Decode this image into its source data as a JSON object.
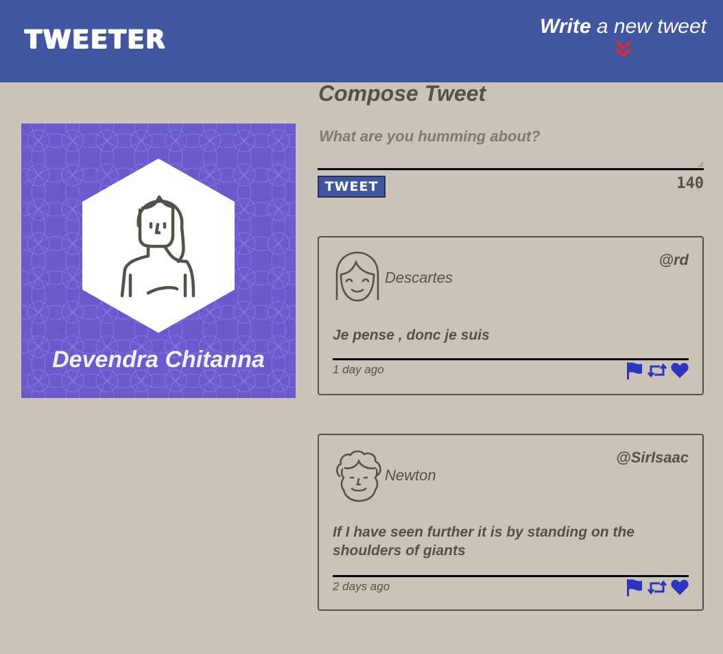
{
  "nav": {
    "logo": "TWEETER",
    "write_strong": "Write",
    "write_rest": " a new tweet",
    "chevron_color": "#e0282d",
    "icon": "double-chevron-down-icon"
  },
  "profile": {
    "name": "Devendra Chitanna",
    "background_color": "#6a5acd",
    "avatar_icon": "woman-avatar-icon"
  },
  "compose": {
    "title": "Compose Tweet",
    "placeholder": "What are you humming about?",
    "button_label": "TWEET",
    "counter": "140"
  },
  "tweets": [
    {
      "display_name": "Descartes",
      "handle": "@rd",
      "content": "Je pense , donc je suis",
      "age": "1 day ago",
      "avatar_icon": "smiling-girl-avatar-icon"
    },
    {
      "display_name": "Newton",
      "handle": "@SirIsaac",
      "content": "If I have seen further it is by standing on the shoulders of giants",
      "age": "2 days ago",
      "avatar_icon": "curly-hair-avatar-icon"
    }
  ],
  "colors": {
    "nav": "#4056a1",
    "page": "#cbc3b8",
    "text": "#545149",
    "action_icons": "#2a35c4"
  }
}
